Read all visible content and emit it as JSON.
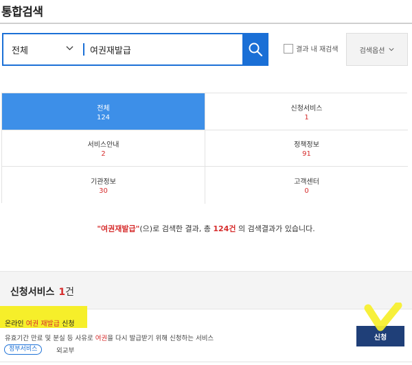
{
  "page_title": "통합검색",
  "search": {
    "scope": "전체",
    "query": "여권재발급",
    "research_label": "결과 내 재검색",
    "options_label": "검색옵션"
  },
  "categories": [
    {
      "label": "전체",
      "count": "124",
      "active": true
    },
    {
      "label": "신청서비스",
      "count": "1",
      "active": false
    },
    {
      "label": "서비스안내",
      "count": "2",
      "active": false
    },
    {
      "label": "정책정보",
      "count": "91",
      "active": false
    },
    {
      "label": "기관정보",
      "count": "30",
      "active": false
    },
    {
      "label": "고객센터",
      "count": "0",
      "active": false
    }
  ],
  "summary": {
    "query_quoted": "\"여권재발급\"",
    "text_mid": "(으)로 검색한 결과, 총 ",
    "total": "124건",
    "text_end": " 의 검색결과가 있습니다."
  },
  "section": {
    "title": "신청서비스",
    "count": "1",
    "unit": "건"
  },
  "result": {
    "title_pre": "온라인 ",
    "title_kw": "여권 재발급",
    "title_post": " 신청",
    "desc_pre": "유효기간 만료 및 분실 등 사유로 ",
    "desc_kw": "여권",
    "desc_post": "을 다시 발급받기 위해 신청하는 서비스",
    "tag": "정부서비스",
    "agency": "외교부",
    "apply_label": "신청"
  },
  "colors": {
    "accent": "#1a6fd6",
    "active_tab": "#3d8fe8",
    "highlight": "#d62c2c",
    "apply_button": "#1f3f78",
    "annotation_marker": "#f6ef2a"
  }
}
